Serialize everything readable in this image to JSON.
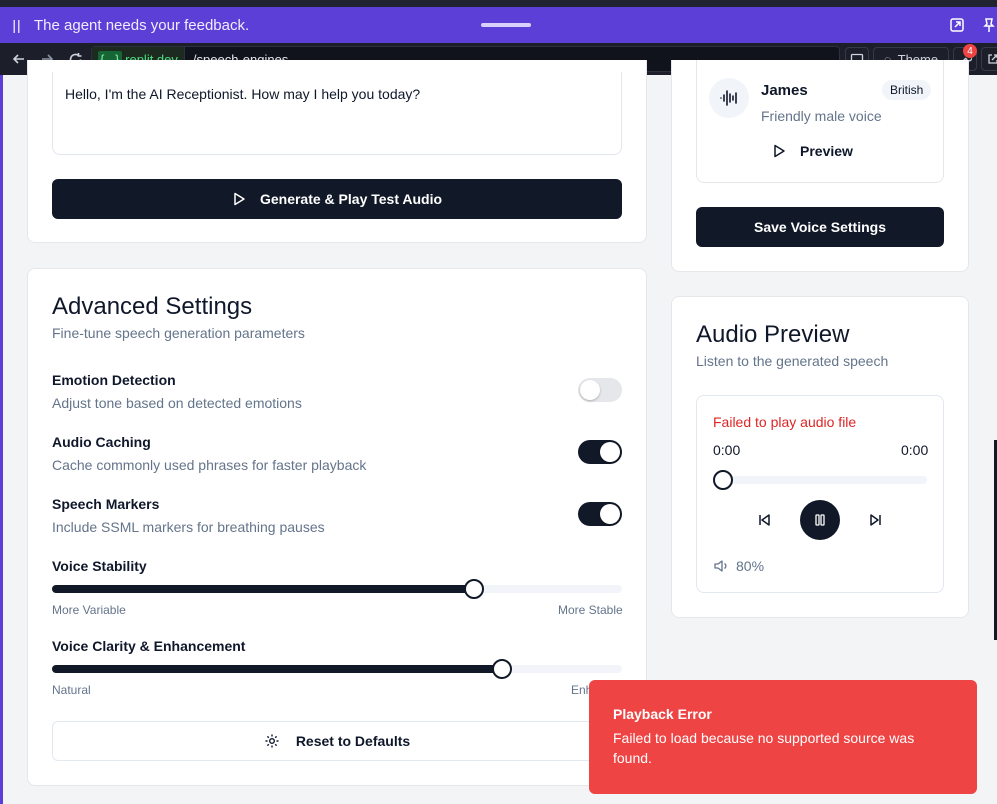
{
  "agent_bar": {
    "message": "The agent needs your feedback."
  },
  "browser": {
    "host_brace": "{...}",
    "host_rest": ".replit.dev",
    "path": "/speech-engines",
    "theme_label": "Theme",
    "notification_count": "4"
  },
  "test_card": {
    "textarea_text": "Hello, I'm the AI Receptionist. How may I help you today?",
    "generate_label": "Generate & Play Test Audio"
  },
  "advanced": {
    "title": "Advanced Settings",
    "subtitle": "Fine-tune speech generation parameters",
    "toggles": [
      {
        "label": "Emotion Detection",
        "desc": "Adjust tone based on detected emotions",
        "on": false
      },
      {
        "label": "Audio Caching",
        "desc": "Cache commonly used phrases for faster playback",
        "on": true
      },
      {
        "label": "Speech Markers",
        "desc": "Include SSML markers for breathing pauses",
        "on": true
      }
    ],
    "sliders": [
      {
        "label": "Voice Stability",
        "min_label": "More Variable",
        "max_label": "More Stable",
        "value": 0.74
      },
      {
        "label": "Voice Clarity & Enhancement",
        "min_label": "Natural",
        "max_label": "Enh",
        "value": 0.79
      }
    ],
    "reset_label": "Reset to Defaults"
  },
  "voice_card": {
    "name": "James",
    "accent": "British",
    "description": "Friendly male voice",
    "preview_label": "Preview",
    "save_label": "Save Voice Settings"
  },
  "audio_preview": {
    "title": "Audio Preview",
    "subtitle": "Listen to the generated speech",
    "error": "Failed to play audio file",
    "current_time": "0:00",
    "duration": "0:00",
    "progress": 0,
    "volume": "80%"
  },
  "toast": {
    "title": "Playback Error",
    "message": "Failed to load because no supported source was found."
  }
}
